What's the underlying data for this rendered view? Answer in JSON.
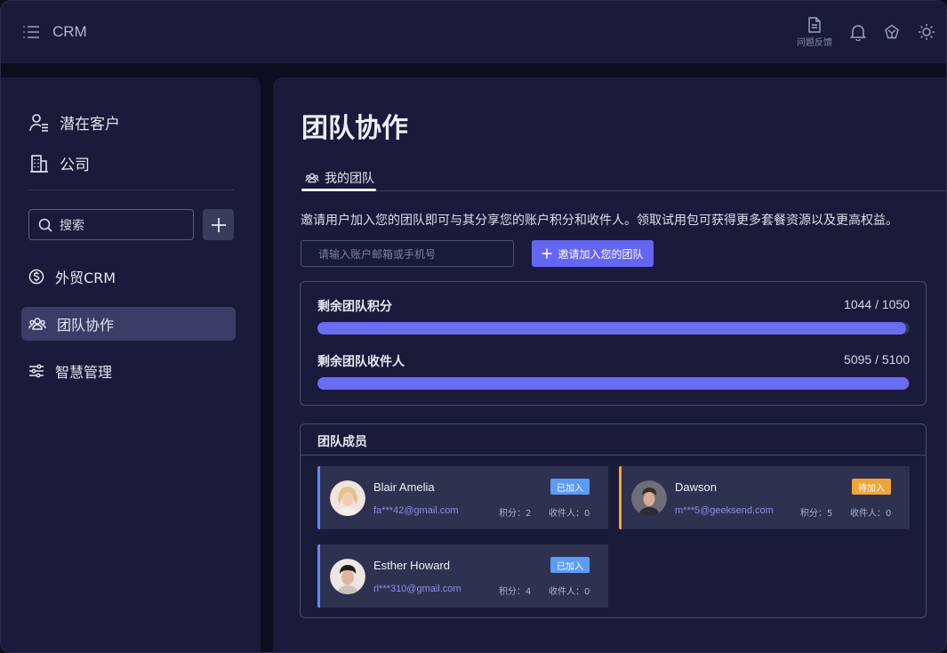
{
  "header": {
    "brand": "CRM",
    "feedback_label": "问题反馈"
  },
  "sidebar": {
    "top_items": [
      {
        "label": "潜在客户",
        "icon": "user-list-icon"
      },
      {
        "label": "公司",
        "icon": "building-icon"
      }
    ],
    "search_placeholder": "搜索",
    "nav": [
      {
        "label": "外贸CRM",
        "icon": "dollar-circle-icon",
        "active": false
      },
      {
        "label": "团队协作",
        "icon": "team-icon",
        "active": true
      },
      {
        "label": "智慧管理",
        "icon": "sliders-icon",
        "active": false
      }
    ]
  },
  "main": {
    "title": "团队协作",
    "tab_label": "我的团队",
    "description": "邀请用户加入您的团队即可与其分享您的账户积分和收件人。领取试用包可获得更多套餐资源以及更高权益。",
    "invite_placeholder": "请输入账户邮箱或手机号",
    "invite_button": "邀请加入您的团队",
    "quota": [
      {
        "label": "剩余团队积分",
        "value_text": "1044 / 1050",
        "used": 1044,
        "total": 1050
      },
      {
        "label": "剩余团队收件人",
        "value_text": "5095 / 5100",
        "used": 5095,
        "total": 5100
      }
    ],
    "members_title": "团队成员",
    "members": [
      {
        "name": "Blair Amelia",
        "email": "fa***42@gmail.com",
        "points": "积分：2",
        "recipients": "收件人：0",
        "status": "已加入",
        "status_color": "#5b9cf5"
      },
      {
        "name": "Dawson",
        "email": "m***5@geeksend.com",
        "points": "积分：5",
        "recipients": "收件人：0",
        "status": "待加入",
        "status_color": "#f0a53a"
      },
      {
        "name": "Esther Howard",
        "email": "rl***310@gmail.com",
        "points": "积分：4",
        "recipients": "收件人：0",
        "status": "已加入",
        "status_color": "#5b9cf5"
      }
    ]
  },
  "colors": {
    "accent": "#6366f1",
    "joined": "#5b9cf5",
    "pending": "#f0a53a"
  }
}
